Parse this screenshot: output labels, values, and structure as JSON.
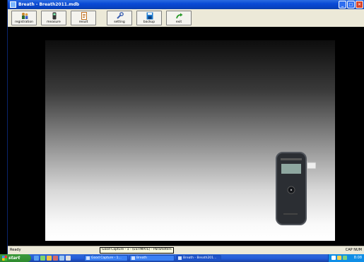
{
  "window": {
    "title": "Breath - Breath2011.mdb"
  },
  "toolbar": {
    "buttons": [
      {
        "label": "registration",
        "icon": "people-icon"
      },
      {
        "label": "measure",
        "icon": "device-icon"
      },
      {
        "label": "result",
        "icon": "document-icon"
      },
      {
        "label": "setting",
        "icon": "wrench-icon"
      },
      {
        "label": "backup",
        "icon": "floppy-icon"
      },
      {
        "label": "exit",
        "icon": "exit-arrow-icon"
      }
    ]
  },
  "statusbar": {
    "left": "Ready",
    "right": "CAP  NUM"
  },
  "taskbar": {
    "start": "start",
    "tasks": [
      {
        "label": "Good Capture - 1..."
      },
      {
        "label": "Breath"
      },
      {
        "label": "Breath - Breath201..."
      }
    ],
    "tooltip": "Good Capture - 1 - (ESTIMATE) - Parameters",
    "clock": "8:08"
  },
  "colors": {
    "accent": "#0a4bd6",
    "toolbar_bg": "#ece9d8",
    "taskbar": "#245edb",
    "start": "#2e8a2e"
  }
}
